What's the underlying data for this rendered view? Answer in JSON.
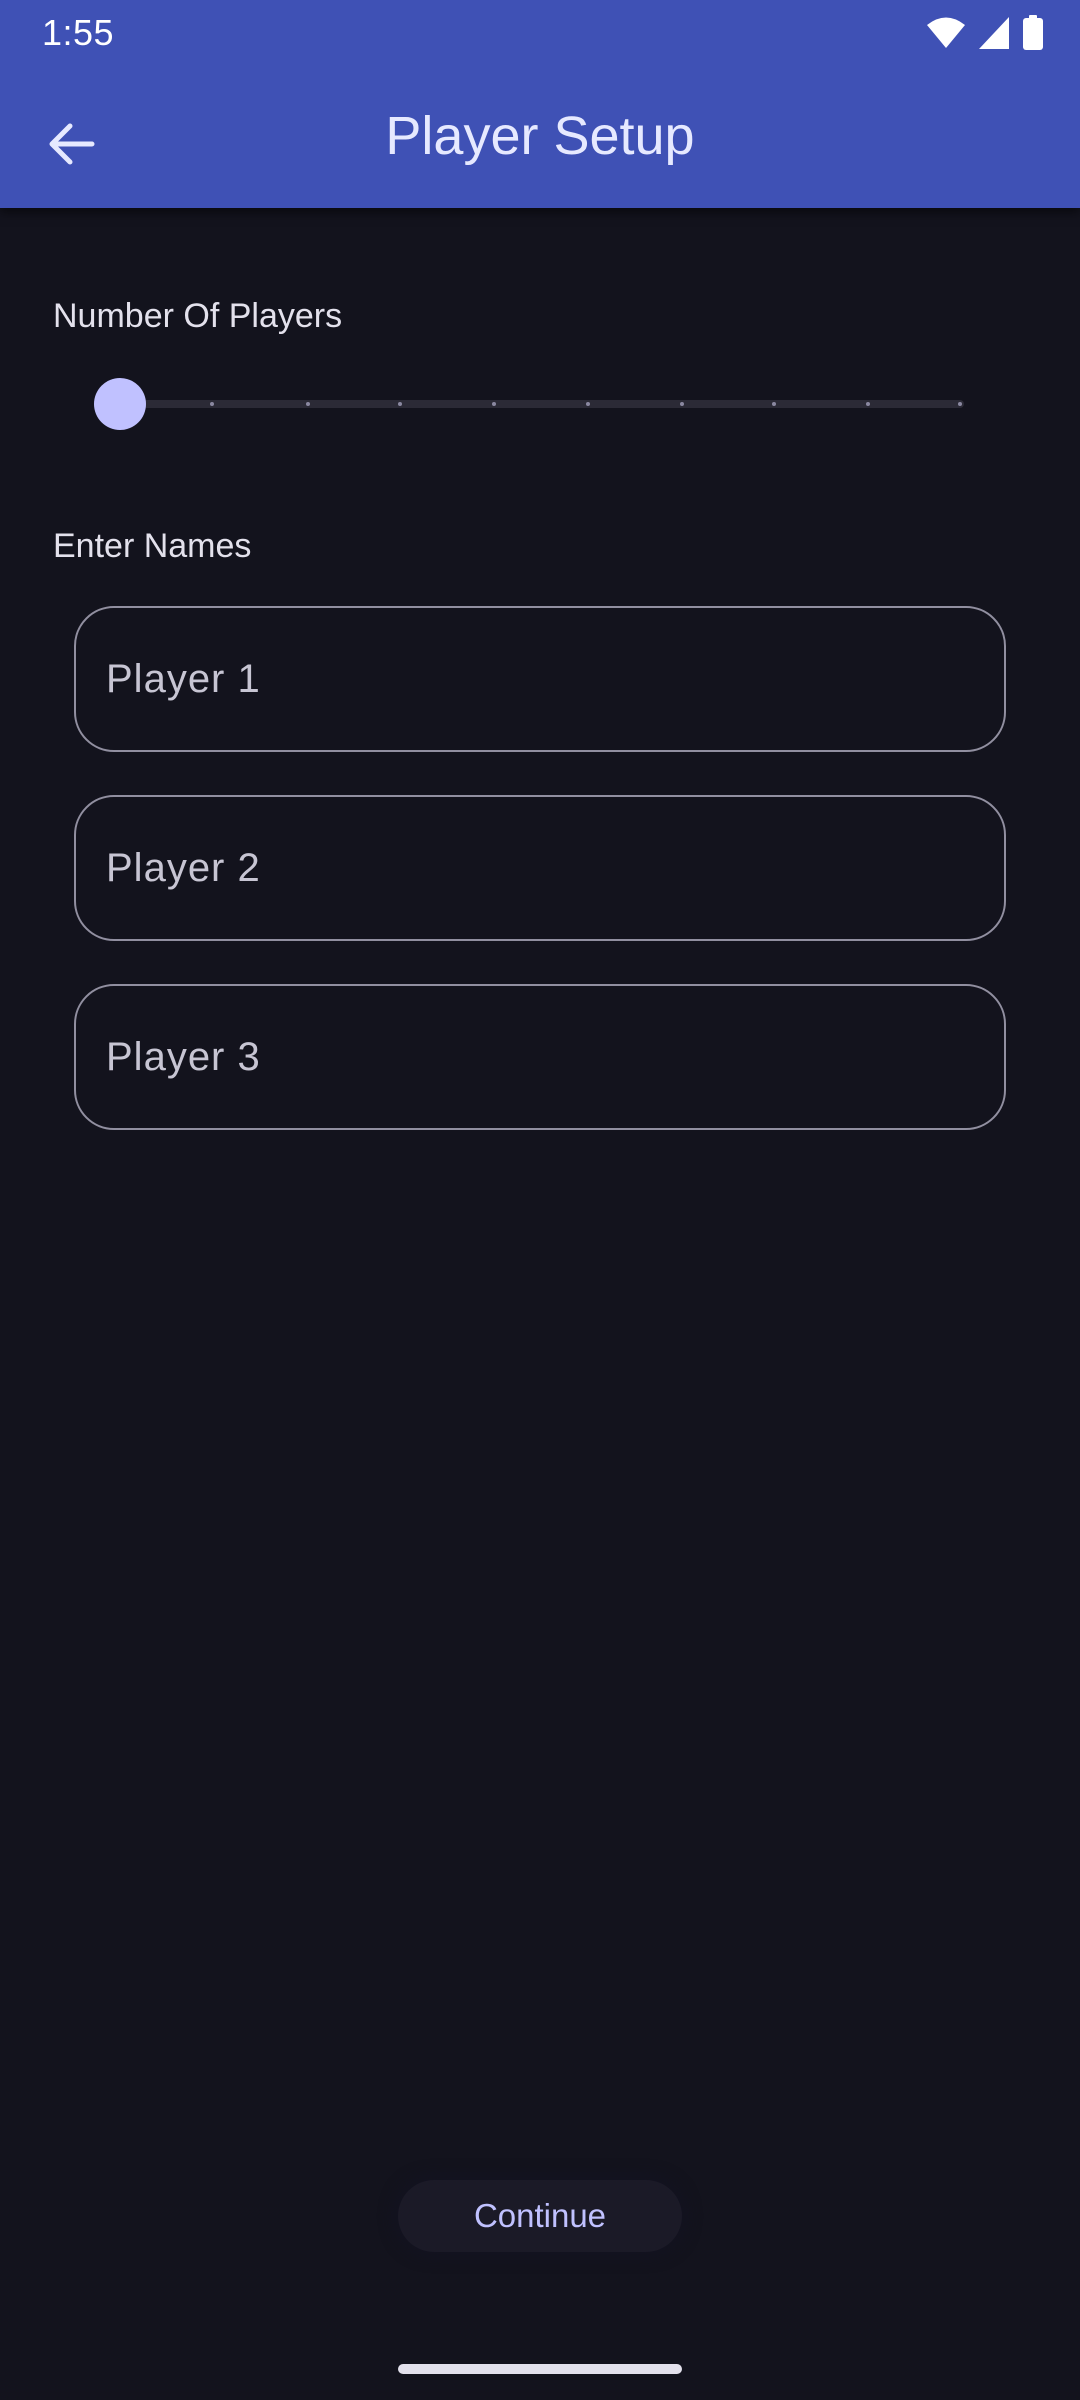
{
  "status_bar": {
    "time": "1:55",
    "icons": [
      "wifi-icon",
      "cell-signal-icon",
      "battery-icon"
    ]
  },
  "app_bar": {
    "title": "Player Setup",
    "back_icon": "arrow-back-icon",
    "background_color": "#3f51b5"
  },
  "players_section": {
    "label": "Number Of Players",
    "slider": {
      "value": 3,
      "min": 3,
      "max": 12,
      "thumb_color": "#c0c1ff"
    }
  },
  "names_section": {
    "label": "Enter Names",
    "fields": [
      {
        "placeholder": "Player 1",
        "value": ""
      },
      {
        "placeholder": "Player 2",
        "value": ""
      },
      {
        "placeholder": "Player 3",
        "value": ""
      }
    ]
  },
  "continue_button": {
    "label": "Continue"
  },
  "colors": {
    "background": "#13131d",
    "accent": "#c0c1ff"
  }
}
